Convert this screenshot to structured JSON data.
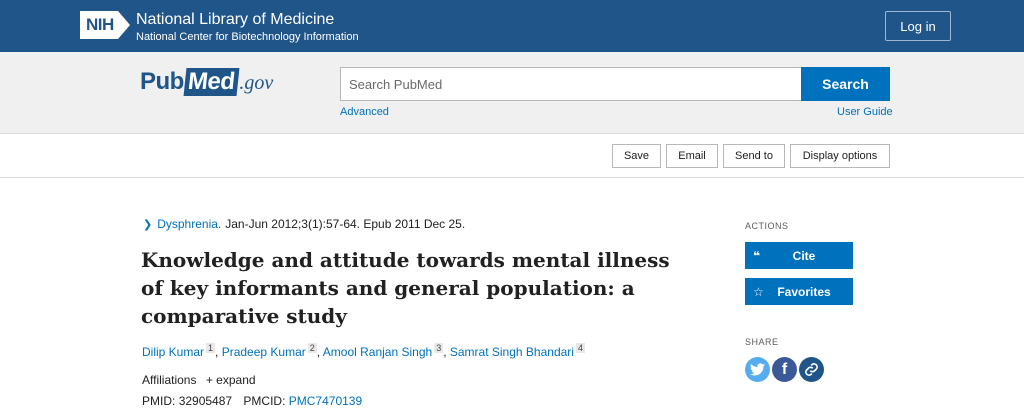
{
  "banner": {
    "logo_text": "NIH",
    "title": "National Library of Medicine",
    "subtitle": "National Center for Biotechnology Information",
    "login_label": "Log in",
    "color": "#20558a"
  },
  "search": {
    "logo_pub": "Pub",
    "logo_med": "Med",
    "logo_gov": ".gov",
    "placeholder": "Search PubMed",
    "button_label": "Search",
    "advanced_label": "Advanced",
    "user_guide_label": "User Guide",
    "accent": "#0071bc"
  },
  "toolbar": {
    "save_label": "Save",
    "email_label": "Email",
    "send_to_label": "Send to",
    "display_options_label": "Display options"
  },
  "article": {
    "journal": "Dysphrenia.",
    "citation": "Jan-Jun 2012;3(1):57-64. Epub 2011 Dec 25.",
    "title": "Knowledge and attitude towards mental illness of key informants and general population: a comparative study",
    "authors": [
      {
        "name": "Dilip Kumar",
        "aff": "1"
      },
      {
        "name": "Pradeep Kumar",
        "aff": "2"
      },
      {
        "name": "Amool Ranjan Singh",
        "aff": "3"
      },
      {
        "name": "Samrat Singh Bhandari",
        "aff": "4"
      }
    ],
    "affiliations_label": "Affiliations",
    "expand_label": "+ expand",
    "pmid_label": "PMID:",
    "pmid": "32905487",
    "pmcid_label": "PMCID:",
    "pmcid": "PMC7470139"
  },
  "sidebar": {
    "actions_label": "ACTIONS",
    "cite_label": "Cite",
    "favorites_label": "Favorites",
    "share_label": "SHARE",
    "share_icons": [
      "twitter-icon",
      "facebook-icon",
      "permalink-icon"
    ]
  }
}
